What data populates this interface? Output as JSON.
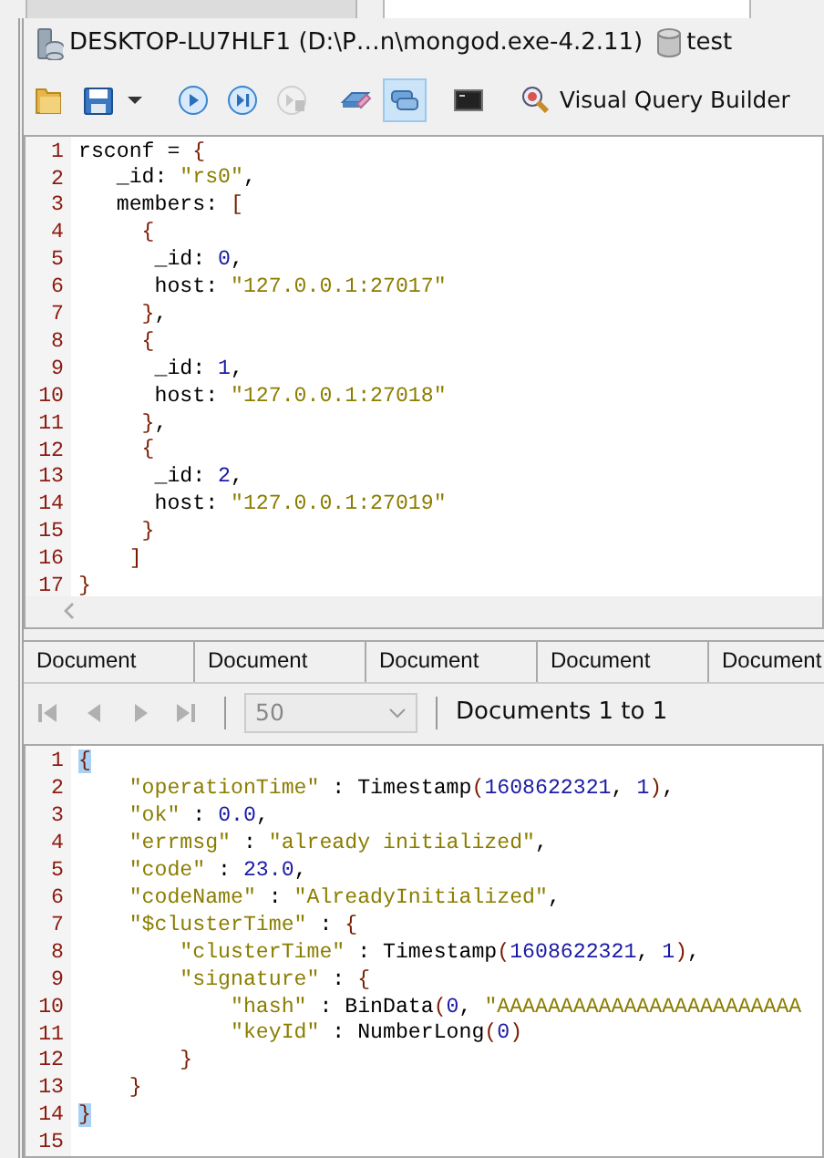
{
  "top_tabs": [
    {
      "selected": false
    },
    {
      "selected": true
    }
  ],
  "connection": {
    "server": "DESKTOP-LU7HLF1 (D:\\P…n\\mongod.exe-4.2.11)",
    "database": "test"
  },
  "toolbar": [
    {
      "kind": "folder",
      "disabled": false,
      "selected": false
    },
    {
      "kind": "save",
      "disabled": false,
      "selected": false
    },
    {
      "kind": "caret",
      "disabled": false,
      "selected": false
    },
    {
      "kind": "run",
      "disabled": false,
      "selected": false
    },
    {
      "kind": "step",
      "disabled": false,
      "selected": false
    },
    {
      "kind": "stop",
      "disabled": true,
      "selected": false
    },
    {
      "kind": "eraser",
      "disabled": false,
      "selected": false
    },
    {
      "kind": "tiles",
      "disabled": false,
      "selected": true
    },
    {
      "kind": "shell",
      "disabled": false,
      "selected": false
    },
    {
      "kind": "query",
      "label": "Visual Query Builder",
      "disabled": false,
      "selected": false
    }
  ],
  "editor": {
    "lines": [
      {
        "number": "1",
        "code": "rsconf = {"
      },
      {
        "number": "2",
        "code": "   _id: \"rs0\","
      },
      {
        "number": "3",
        "code": "   members: ["
      },
      {
        "number": "4",
        "code": "     {"
      },
      {
        "number": "5",
        "code": "      _id: 0,"
      },
      {
        "number": "6",
        "code": "      host: \"127.0.0.1:27017\""
      },
      {
        "number": "7",
        "code": "     },"
      },
      {
        "number": "8",
        "code": "     {"
      },
      {
        "number": "9",
        "code": "      _id: 1,"
      },
      {
        "number": "10",
        "code": "      host: \"127.0.0.1:27018\""
      },
      {
        "number": "11",
        "code": "     },"
      },
      {
        "number": "12",
        "code": "     {"
      },
      {
        "number": "13",
        "code": "      _id: 2,"
      },
      {
        "number": "14",
        "code": "      host: \"127.0.0.1:27019\""
      },
      {
        "number": "15",
        "code": "     }"
      },
      {
        "number": "16",
        "code": "    ]"
      },
      {
        "number": "17",
        "code": "}"
      }
    ]
  },
  "result_tabs": [
    {
      "label": "Document"
    },
    {
      "label": "Document"
    },
    {
      "label": "Document"
    },
    {
      "label": "Document"
    },
    {
      "label": "Document"
    }
  ],
  "pager": {
    "navigation_disabled": true,
    "page_size": "50",
    "page_size_disabled": true,
    "status": "Documents 1 to 1"
  },
  "result": {
    "lines": [
      {
        "number": "1",
        "code": "{",
        "brace_match": true
      },
      {
        "number": "2",
        "code": "    \"operationTime\" : Timestamp(1608622321, 1),",
        "brace_match": false
      },
      {
        "number": "3",
        "code": "    \"ok\" : 0.0,",
        "brace_match": false
      },
      {
        "number": "4",
        "code": "    \"errmsg\" : \"already initialized\",",
        "brace_match": false
      },
      {
        "number": "5",
        "code": "    \"code\" : 23.0,",
        "brace_match": false
      },
      {
        "number": "6",
        "code": "    \"codeName\" : \"AlreadyInitialized\",",
        "brace_match": false
      },
      {
        "number": "7",
        "code": "    \"$clusterTime\" : {",
        "brace_match": false
      },
      {
        "number": "8",
        "code": "        \"clusterTime\" : Timestamp(1608622321, 1),",
        "brace_match": false
      },
      {
        "number": "9",
        "code": "        \"signature\" : {",
        "brace_match": false
      },
      {
        "number": "10",
        "code": "            \"hash\" : BinData(0, \"AAAAAAAAAAAAAAAAAAAAAAAA",
        "brace_match": false
      },
      {
        "number": "11",
        "code": "            \"keyId\" : NumberLong(0)",
        "brace_match": false
      },
      {
        "number": "12",
        "code": "        }",
        "brace_match": false
      },
      {
        "number": "13",
        "code": "    }",
        "brace_match": false
      },
      {
        "number": "14",
        "code": "}",
        "brace_match": true
      },
      {
        "number": "15"
      }
    ]
  }
}
